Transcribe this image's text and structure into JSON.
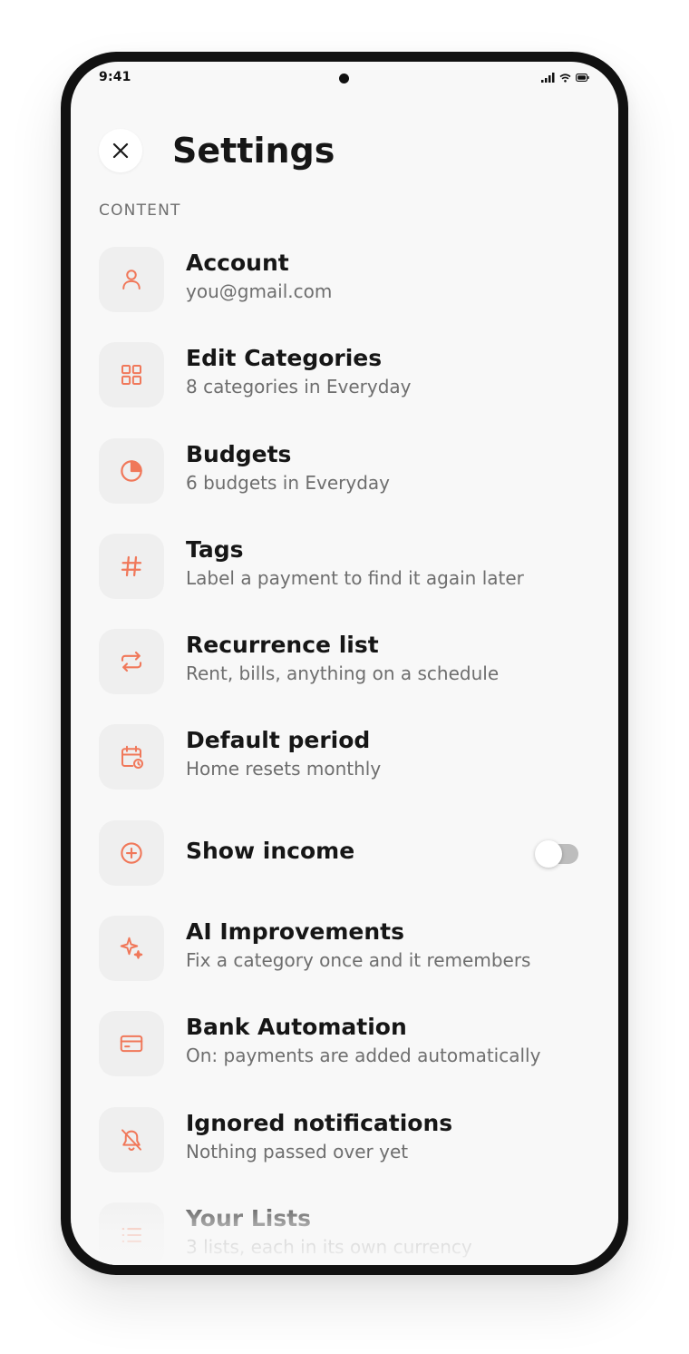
{
  "status_bar": {
    "time": "9:41",
    "icons": [
      "signal-icon",
      "wifi-icon",
      "battery-icon"
    ]
  },
  "header": {
    "close_icon": "close-icon",
    "title": "Settings"
  },
  "section": {
    "label": "CONTENT"
  },
  "accent_color": "#f0785a",
  "items": [
    {
      "icon": "user-icon",
      "title": "Account",
      "subtitle": "you@gmail.com"
    },
    {
      "icon": "grid-icon",
      "title": "Edit Categories",
      "subtitle": "8 categories in Everyday"
    },
    {
      "icon": "pie-chart-icon",
      "title": "Budgets",
      "subtitle": "6 budgets in Everyday"
    },
    {
      "icon": "hash-icon",
      "title": "Tags",
      "subtitle": "Label a payment to find it again later"
    },
    {
      "icon": "repeat-icon",
      "title": "Recurrence list",
      "subtitle": "Rent, bills, anything on a schedule"
    },
    {
      "icon": "calendar-clock-icon",
      "title": "Default period",
      "subtitle": "Home resets monthly"
    },
    {
      "icon": "plus-circle-icon",
      "title": "Show income",
      "toggle_on": false
    },
    {
      "icon": "sparkles-icon",
      "title": "AI Improvements",
      "subtitle": "Fix a category once and it remembers"
    },
    {
      "icon": "credit-card-icon",
      "title": "Bank Automation",
      "subtitle": "On: payments are added automatically"
    },
    {
      "icon": "bell-off-icon",
      "title": "Ignored notifications",
      "subtitle": "Nothing passed over yet"
    },
    {
      "icon": "list-icon",
      "title": "Your Lists",
      "subtitle": "3 lists, each in its own currency"
    }
  ]
}
